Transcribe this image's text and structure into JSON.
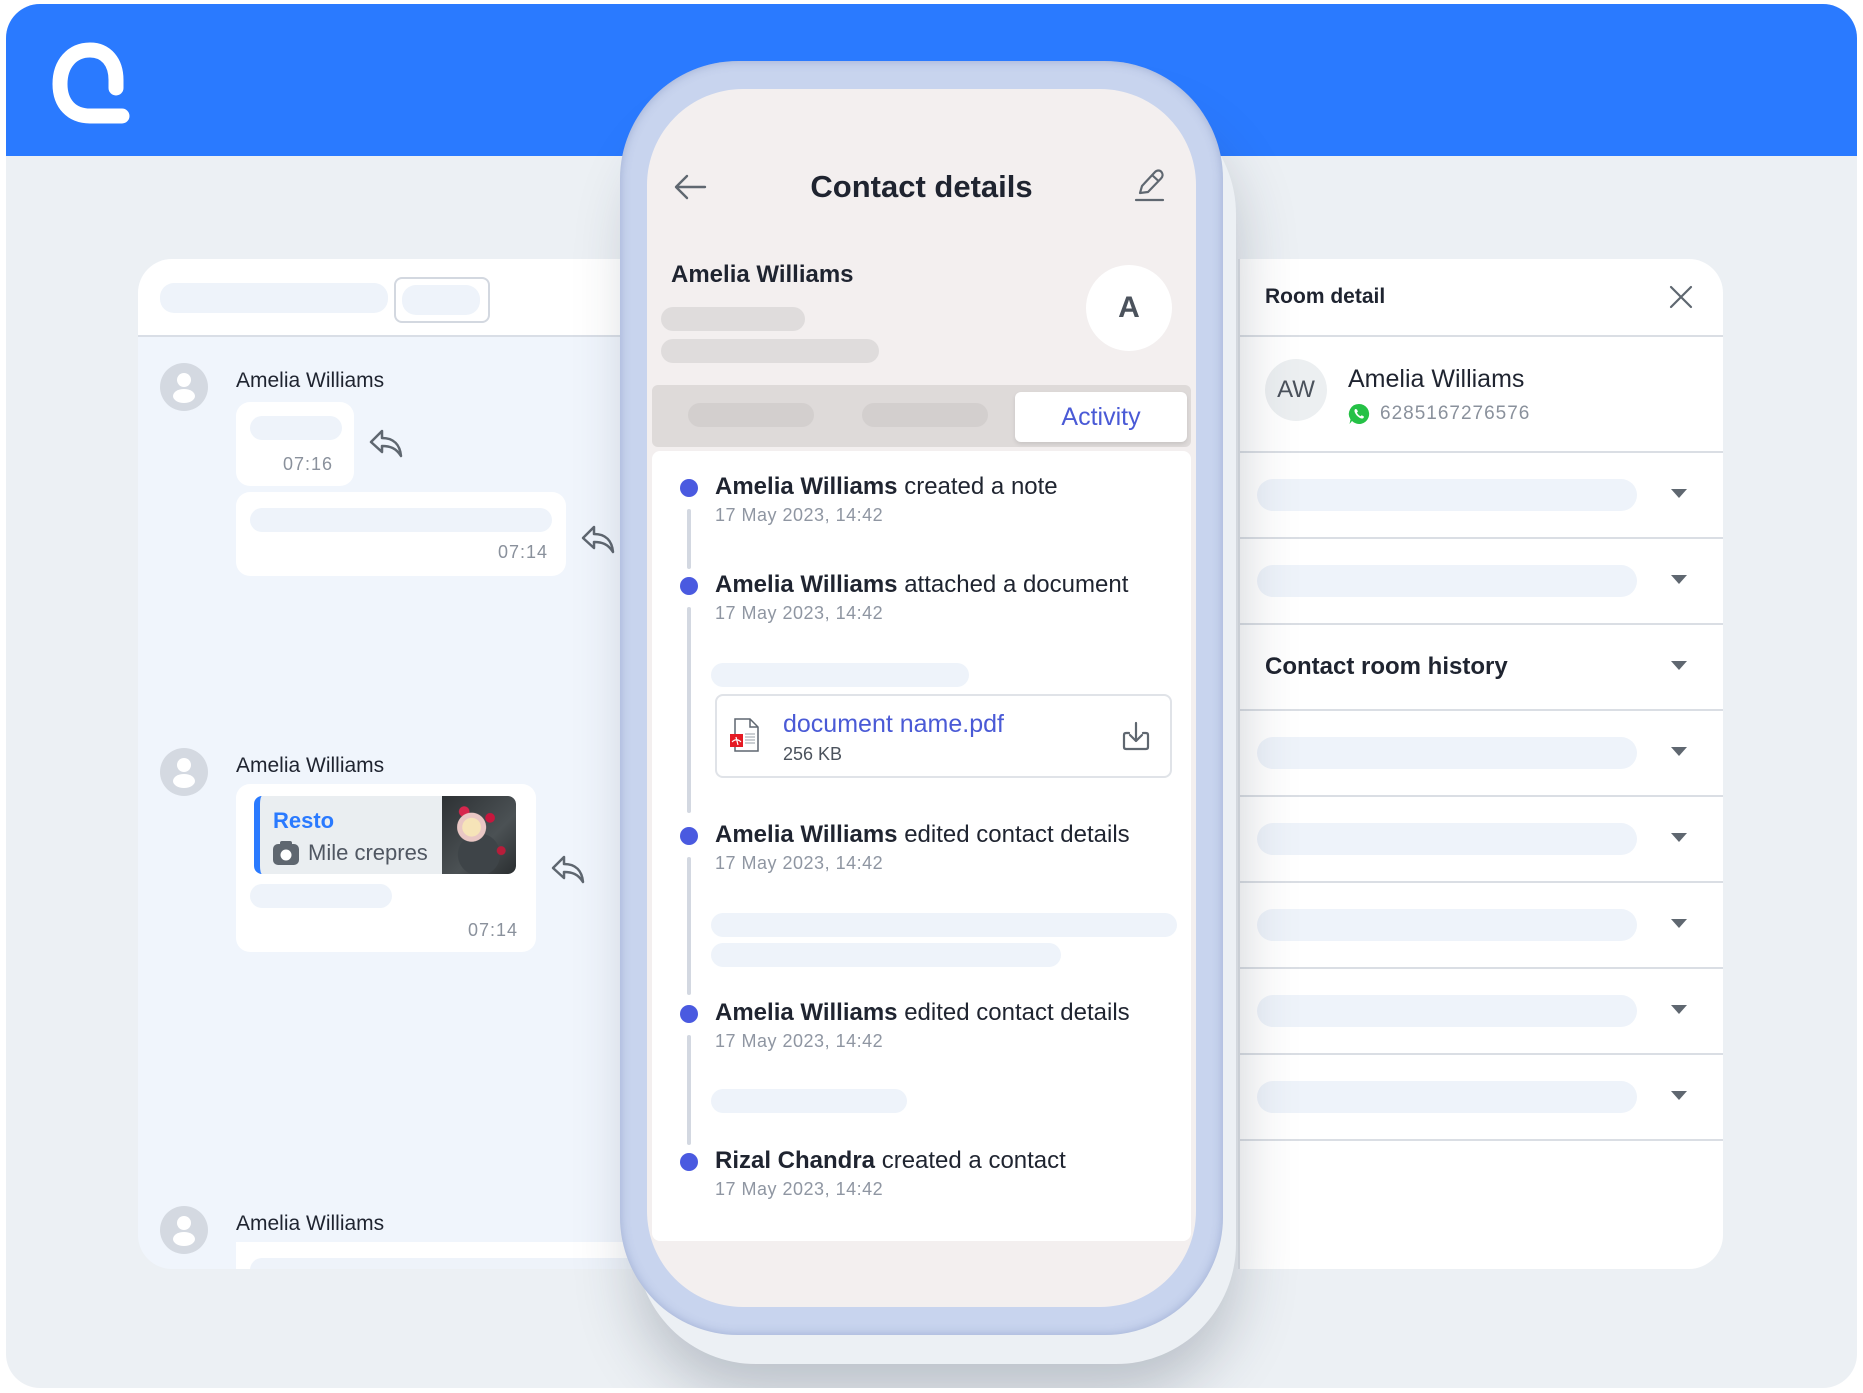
{
  "app": {
    "brand_color": "#2a7aff",
    "logo_icon": "qontak-style-logo"
  },
  "chat": {
    "messages": [
      {
        "sender": "Amelia Williams",
        "bubbles": [
          {
            "time": "07:16"
          },
          {
            "time": "07:14"
          }
        ]
      },
      {
        "sender": "Amelia Williams",
        "quote": {
          "title": "Resto",
          "subtitle": "Mile crepres"
        },
        "time": "07:14"
      },
      {
        "sender": "Amelia Williams"
      }
    ]
  },
  "phone": {
    "title": "Contact details",
    "contact_name": "Amelia Williams",
    "avatar_initial": "A",
    "active_tab": "Activity",
    "activities": [
      {
        "actor": "Amelia Williams",
        "action": "created a note",
        "timestamp": "17 May 2023, 14:42"
      },
      {
        "actor": "Amelia Williams",
        "action": "attached a document",
        "timestamp": "17 May 2023, 14:42",
        "document": {
          "name": "document name.pdf",
          "size": "256 KB"
        }
      },
      {
        "actor": "Amelia Williams",
        "action": "edited contact details",
        "timestamp": "17 May 2023, 14:42"
      },
      {
        "actor": "Amelia Williams",
        "action": "edited contact details",
        "timestamp": "17 May 2023, 14:42"
      },
      {
        "actor": "Rizal Chandra",
        "action": "created a contact",
        "timestamp": "17 May 2023, 14:42"
      }
    ],
    "accent_color": "#4a5ad6"
  },
  "room": {
    "title": "Room detail",
    "contact": {
      "initials": "AW",
      "name": "Amelia Williams",
      "channel_icon": "whatsapp-icon",
      "phone": "6285167276576"
    },
    "sections": [
      {
        "label": null
      },
      {
        "label": null
      },
      {
        "label": "Contact room history"
      },
      {
        "label": null
      },
      {
        "label": null
      },
      {
        "label": null
      },
      {
        "label": null
      },
      {
        "label": null
      }
    ]
  }
}
